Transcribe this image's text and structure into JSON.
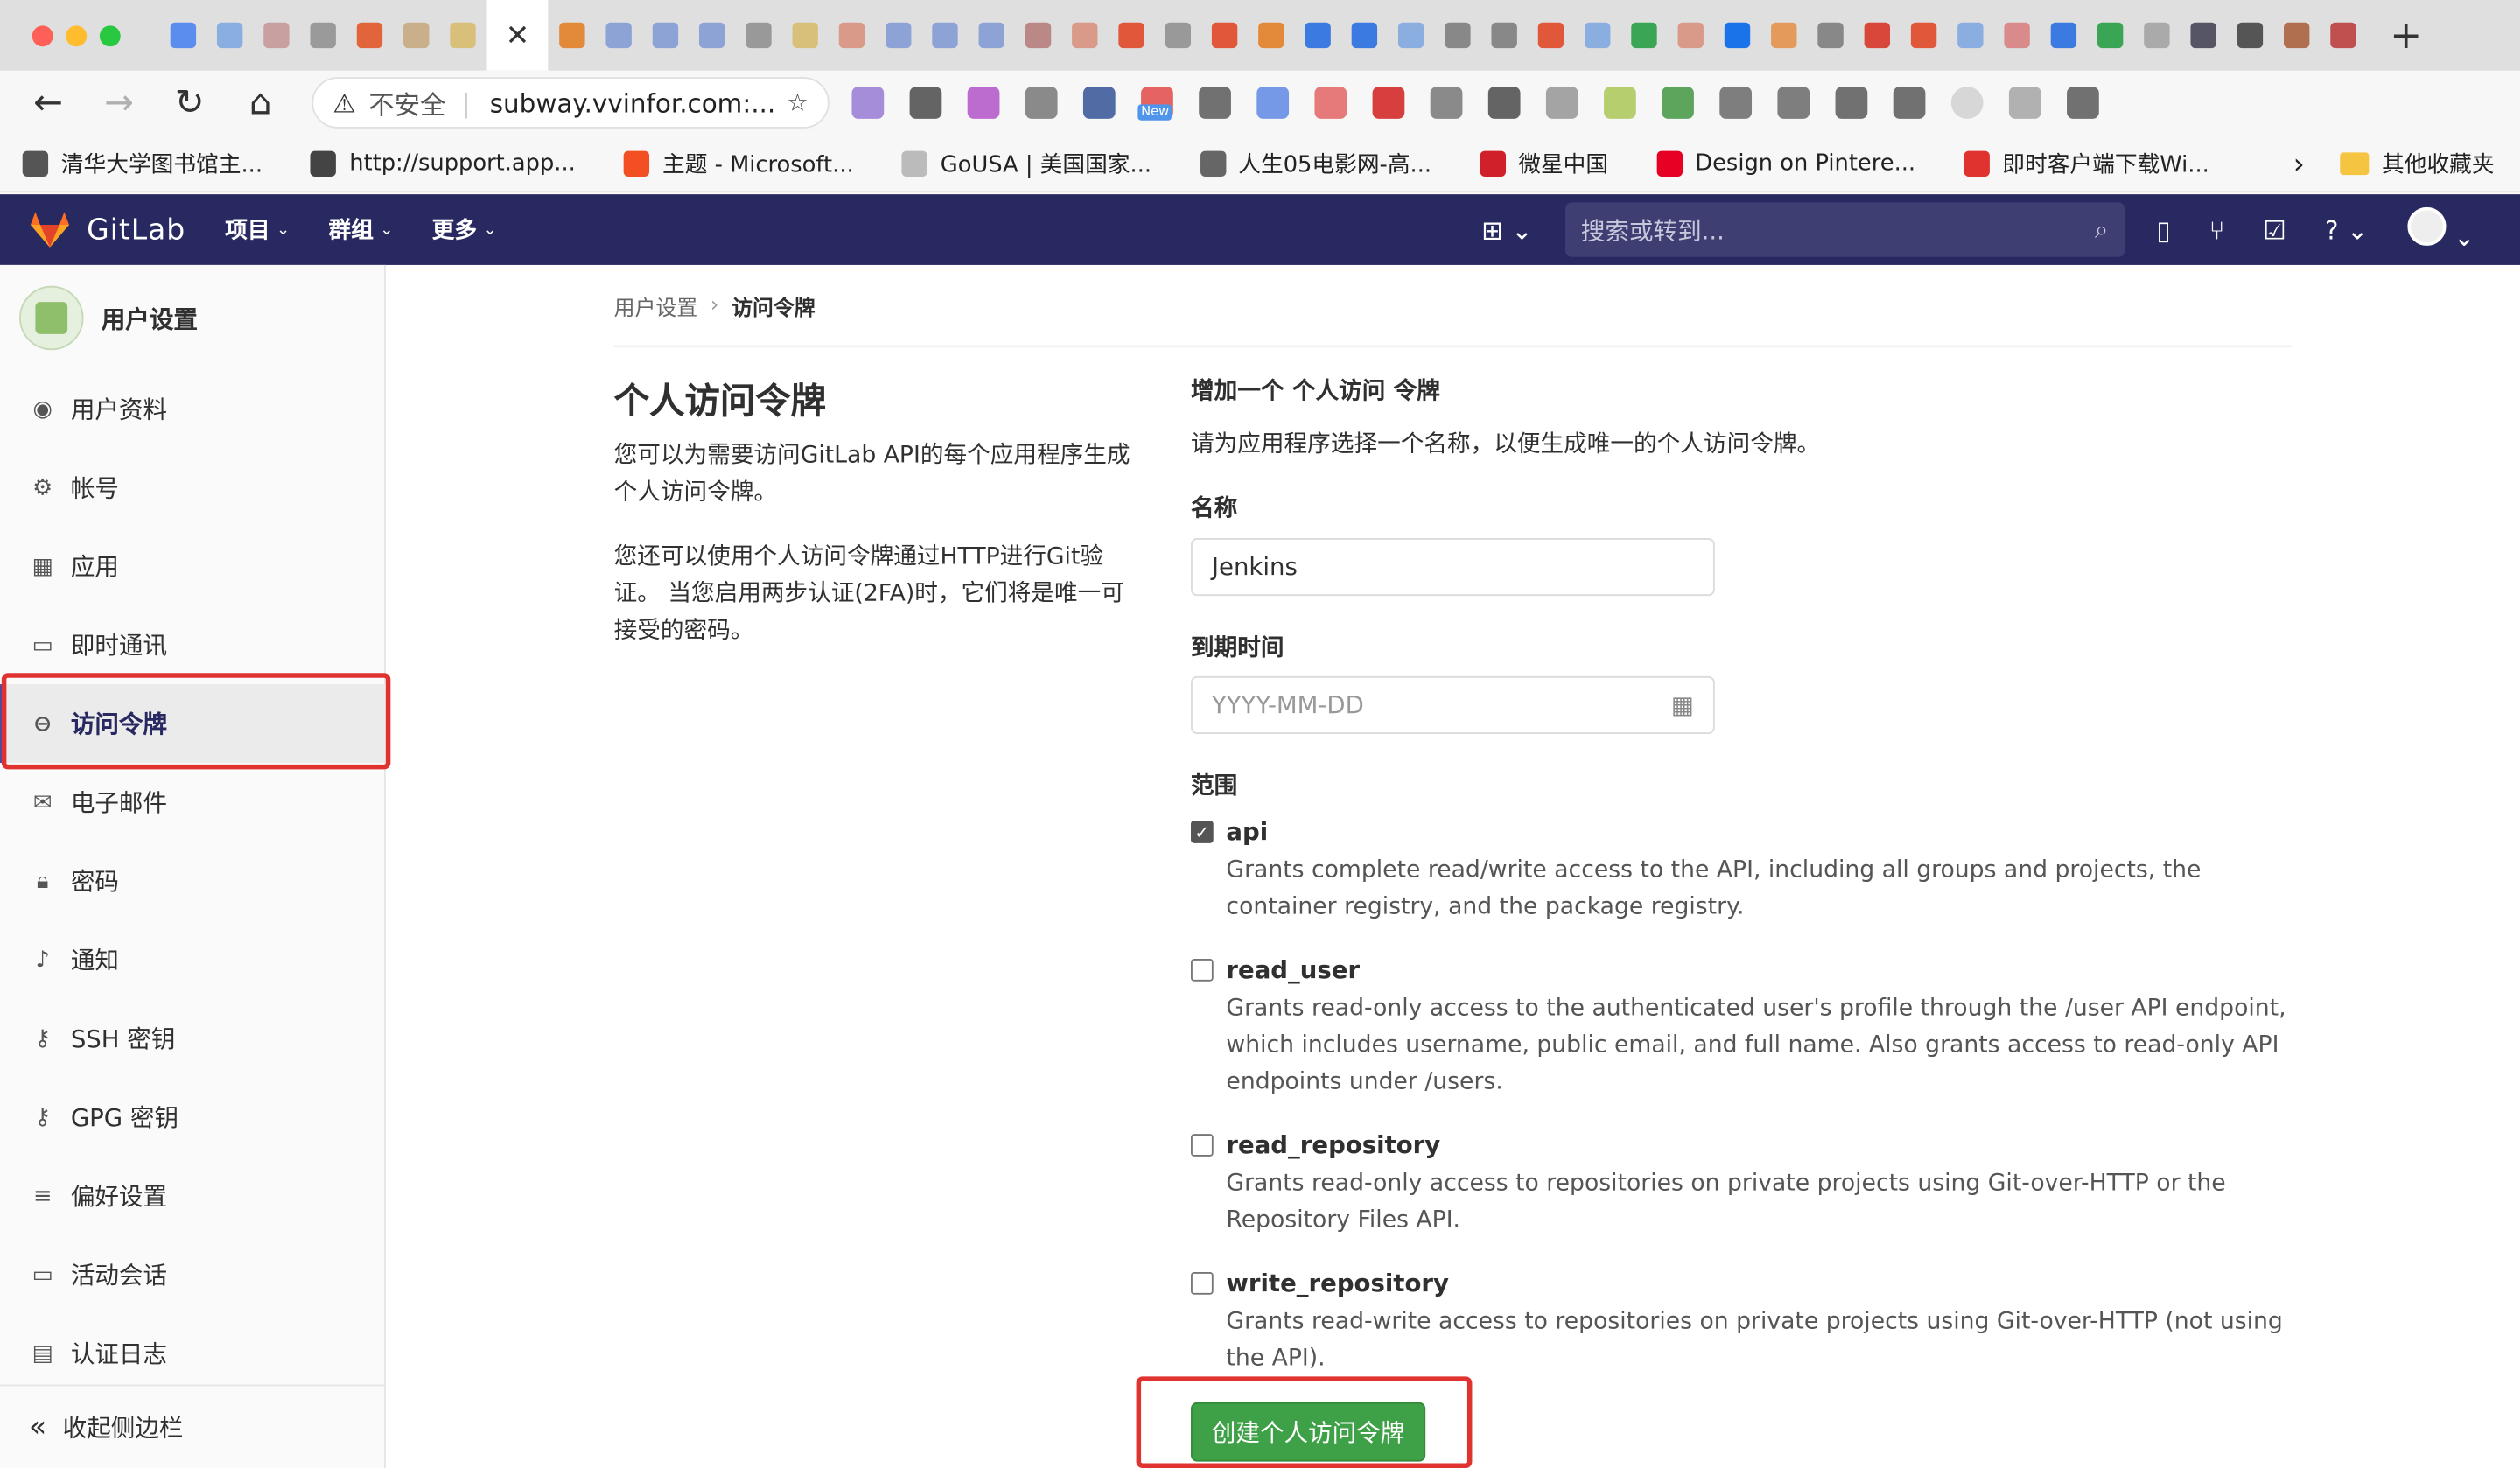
{
  "browser": {
    "address": {
      "insecure_label": "不安全",
      "host": "subway.vvinfor.com:..."
    },
    "extension_badge": "New",
    "bookmarks": [
      {
        "label": "清华大学图书馆主...",
        "color": "#555555"
      },
      {
        "label": "http://support.app...",
        "color": "#444444"
      },
      {
        "label": "主题 - Microsoft...",
        "color": "#f25022"
      },
      {
        "label": "GoUSA | 美国国家...",
        "color": "#bbbbbb"
      },
      {
        "label": "人生05电影网-高...",
        "color": "#666666"
      },
      {
        "label": "微星中国",
        "color": "#d0202a"
      },
      {
        "label": "Design on Pintere...",
        "color": "#e60023"
      },
      {
        "label": "即时客户端下载Wi...",
        "color": "#e0322e"
      }
    ],
    "other_bookmarks": "其他收藏夹"
  },
  "gitlab": {
    "brand": "GitLab",
    "nav": {
      "projects": "项目",
      "groups": "群组",
      "more": "更多"
    },
    "search_placeholder": "搜索或转到..."
  },
  "sidebar": {
    "title": "用户设置",
    "items": [
      {
        "label": "用户资料",
        "icon": "profile-icon"
      },
      {
        "label": "帐号",
        "icon": "account-icon"
      },
      {
        "label": "应用",
        "icon": "applications-icon"
      },
      {
        "label": "即时通讯",
        "icon": "chat-icon"
      },
      {
        "label": "访问令牌",
        "icon": "token-icon"
      },
      {
        "label": "电子邮件",
        "icon": "mail-icon"
      },
      {
        "label": "密码",
        "icon": "lock-icon"
      },
      {
        "label": "通知",
        "icon": "bell-icon"
      },
      {
        "label": "SSH 密钥",
        "icon": "key-icon"
      },
      {
        "label": "GPG 密钥",
        "icon": "key-icon"
      },
      {
        "label": "偏好设置",
        "icon": "preferences-icon"
      },
      {
        "label": "活动会话",
        "icon": "monitor-icon"
      },
      {
        "label": "认证日志",
        "icon": "log-icon"
      }
    ],
    "active_index": 4,
    "collapse": "收起侧边栏"
  },
  "breadcrumb": {
    "parent": "用户设置",
    "current": "访问令牌"
  },
  "page": {
    "title": "个人访问令牌",
    "desc1": "您可以为需要访问GitLab API的每个应用程序生成个人访问令牌。",
    "desc2": "您还可以使用个人访问令牌通过HTTP进行Git验证。 当您启用两步认证(2FA)时，它们将是唯一可接受的密码。"
  },
  "form": {
    "heading": "增加一个 个人访问 令牌",
    "subtitle": "请为应用程序选择一个名称，以便生成唯一的个人访问令牌。",
    "name_label": "名称",
    "name_value": "Jenkins",
    "expires_label": "到期时间",
    "expires_placeholder": "YYYY-MM-DD",
    "scopes_label": "范围",
    "scopes": [
      {
        "name": "api",
        "checked": true,
        "desc": "Grants complete read/write access to the API, including all groups and projects, the container registry, and the package registry."
      },
      {
        "name": "read_user",
        "checked": false,
        "desc": "Grants read-only access to the authenticated user's profile through the /user API endpoint, which includes username, public email, and full name. Also grants access to read-only API endpoints under /users."
      },
      {
        "name": "read_repository",
        "checked": false,
        "desc": "Grants read-only access to repositories on private projects using Git-over-HTTP or the Repository Files API."
      },
      {
        "name": "write_repository",
        "checked": false,
        "desc": "Grants read-write access to repositories on private projects using Git-over-HTTP (not using the API)."
      }
    ],
    "submit": "创建个人访问令牌"
  },
  "colors": {
    "header": "#292961",
    "button": "#3fa147",
    "highlight": "#e0322e"
  }
}
